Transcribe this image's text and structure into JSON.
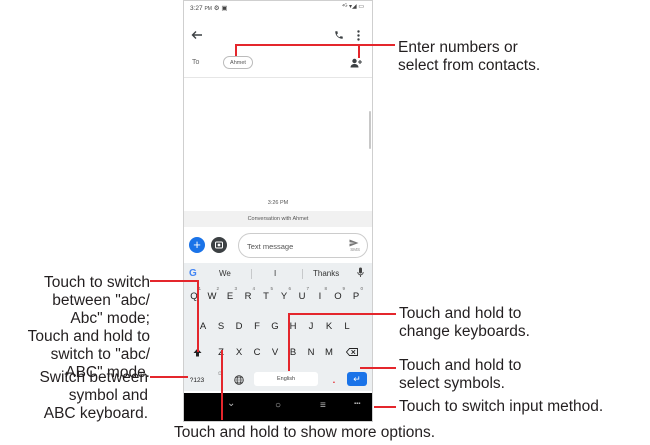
{
  "status_bar": {
    "time": "3:27",
    "meridiem": "PM",
    "right_icons": "⁴ᴳ ▾◢ ▭"
  },
  "recipient": {
    "to_label": "To",
    "chip": "Ahmet"
  },
  "conversation": {
    "timestamp": "3:26 PM",
    "banner": "Conversation with Ahmet"
  },
  "composer": {
    "placeholder": "Text message",
    "send_sub": "SMS"
  },
  "keyboard": {
    "suggestions": [
      "We",
      "I",
      "Thanks"
    ],
    "row1": [
      "Q",
      "W",
      "E",
      "R",
      "T",
      "Y",
      "U",
      "I",
      "O",
      "P"
    ],
    "row1_hints": [
      "1",
      "2",
      "3",
      "4",
      "5",
      "6",
      "7",
      "8",
      "9",
      "0"
    ],
    "row2": [
      "A",
      "S",
      "D",
      "F",
      "G",
      "H",
      "J",
      "K",
      "L"
    ],
    "row3": [
      "Z",
      "X",
      "C",
      "V",
      "B",
      "N",
      "M"
    ],
    "symbols_key": "?123",
    "space_label": "English",
    "period_key": "."
  },
  "callouts": {
    "enter_numbers": [
      "Enter numbers or",
      "select from contacts."
    ],
    "touch_switch": [
      "Touch to switch",
      "between \"abc/",
      "Abc\" mode;",
      "Touch and hold to",
      "switch to \"abc/",
      "ABC\" mode."
    ],
    "change_keyboards": [
      "Touch and hold to",
      "change keyboards."
    ],
    "select_symbols": [
      "Touch and hold to",
      "select symbols."
    ],
    "switch_symbol": [
      "Switch between",
      "symbol and",
      "ABC keyboard."
    ],
    "input_method": "Touch to switch input method.",
    "more_options": "Touch and hold to show more options."
  },
  "colors": {
    "accent": "#1a73e8",
    "callout_line": "#e4262c"
  }
}
